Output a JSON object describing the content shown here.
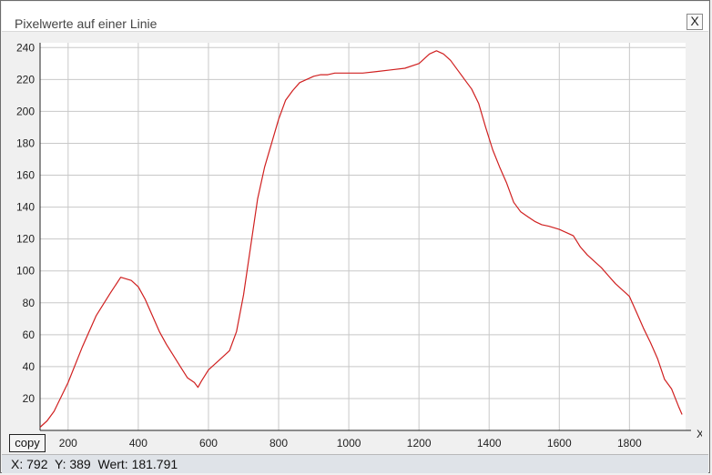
{
  "window": {
    "title": "Pixelwerte auf einer Linie",
    "close_label": "X"
  },
  "buttons": {
    "copy_label": "copy"
  },
  "status": {
    "text": "X: 792  Y: 389  Wert: 181.791"
  },
  "colors": {
    "line": "#d02020",
    "grid": "#c8c8c8",
    "axis": "#222222"
  },
  "chart_data": {
    "type": "line",
    "title": "",
    "xlabel": "X",
    "ylabel": "",
    "xlim": [
      120,
      1960
    ],
    "ylim": [
      0,
      243
    ],
    "x_ticks": [
      200,
      400,
      600,
      800,
      1000,
      1200,
      1400,
      1600,
      1800
    ],
    "y_ticks": [
      20,
      40,
      60,
      80,
      100,
      120,
      140,
      160,
      180,
      200,
      220,
      240
    ],
    "grid": true,
    "series": [
      {
        "x": [
          120,
          140,
          160,
          200,
          240,
          280,
          320,
          350,
          380,
          400,
          420,
          440,
          460,
          480,
          500,
          520,
          540,
          560,
          570,
          580,
          600,
          620,
          640,
          660,
          680,
          700,
          720,
          740,
          760,
          780,
          800,
          820,
          840,
          860,
          880,
          900,
          920,
          940,
          960,
          1000,
          1040,
          1080,
          1120,
          1160,
          1200,
          1230,
          1250,
          1270,
          1290,
          1310,
          1330,
          1350,
          1370,
          1390,
          1410,
          1430,
          1450,
          1470,
          1490,
          1510,
          1530,
          1550,
          1570,
          1600,
          1620,
          1640,
          1660,
          1680,
          1700,
          1720,
          1740,
          1760,
          1780,
          1800,
          1820,
          1840,
          1860,
          1880,
          1900,
          1920,
          1940,
          1950
        ],
        "y": [
          2,
          6,
          12,
          30,
          52,
          72,
          86,
          96,
          94,
          90,
          82,
          72,
          62,
          54,
          47,
          40,
          33,
          30,
          27,
          31,
          38,
          42,
          46,
          50,
          62,
          85,
          115,
          145,
          165,
          180,
          195,
          207,
          213,
          218,
          220,
          222,
          223,
          223,
          224,
          224,
          224,
          225,
          226,
          227,
          230,
          236,
          238,
          236,
          232,
          226,
          220,
          214,
          205,
          190,
          176,
          165,
          155,
          143,
          137,
          134,
          131,
          129,
          128,
          126,
          124,
          122,
          115,
          110,
          106,
          102,
          97,
          92,
          88,
          84,
          74,
          64,
          55,
          45,
          32,
          26,
          15,
          10
        ]
      }
    ]
  }
}
